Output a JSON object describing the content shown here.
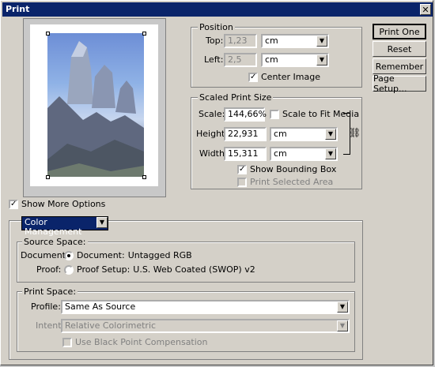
{
  "window": {
    "title": "Print",
    "close_glyph": "✕"
  },
  "buttons": {
    "print_one": "Print One",
    "reset": "Reset",
    "remember": "Remember",
    "page_setup": "Page Setup..."
  },
  "position": {
    "group_label": "Position",
    "top_label": "Top:",
    "top_value": "1,23",
    "top_unit": "cm",
    "left_label": "Left:",
    "left_value": "2,5",
    "left_unit": "cm",
    "center_image_label": "Center Image",
    "center_image_checked": true
  },
  "scaled_print_size": {
    "group_label": "Scaled Print Size",
    "scale_label": "Scale:",
    "scale_value": "144,66%",
    "scale_to_fit_label": "Scale to Fit Media",
    "scale_to_fit_checked": false,
    "height_label": "Height:",
    "height_value": "22,931",
    "height_unit": "cm",
    "width_label": "Width:",
    "width_value": "15,311",
    "width_unit": "cm",
    "show_bounding_box_label": "Show Bounding Box",
    "show_bounding_box_checked": true,
    "print_selected_area_label": "Print Selected Area",
    "print_selected_area_checked": false
  },
  "more_options": {
    "label": "Show More Options",
    "checked": true,
    "dropdown_value": "Color Management"
  },
  "source_space": {
    "group_label": "Source Space:",
    "document_label": "Document:",
    "document_option": "Document:",
    "document_value": "Untagged RGB",
    "proof_label": "Proof:",
    "proof_option": "Proof Setup:",
    "proof_value": "U.S. Web Coated (SWOP) v2"
  },
  "print_space": {
    "group_label": "Print Space:",
    "profile_label": "Profile:",
    "profile_value": "Same As Source",
    "intent_label": "Intent:",
    "intent_value": "Relative Colorimetric",
    "bpc_label": "Use Black Point Compensation"
  },
  "icons": {
    "close": "close-icon",
    "chain": "chain-link-icon",
    "dropdown": "chevron-down-icon"
  },
  "colors": {
    "titlebar": "#0a246a",
    "face": "#d4d0c8"
  }
}
